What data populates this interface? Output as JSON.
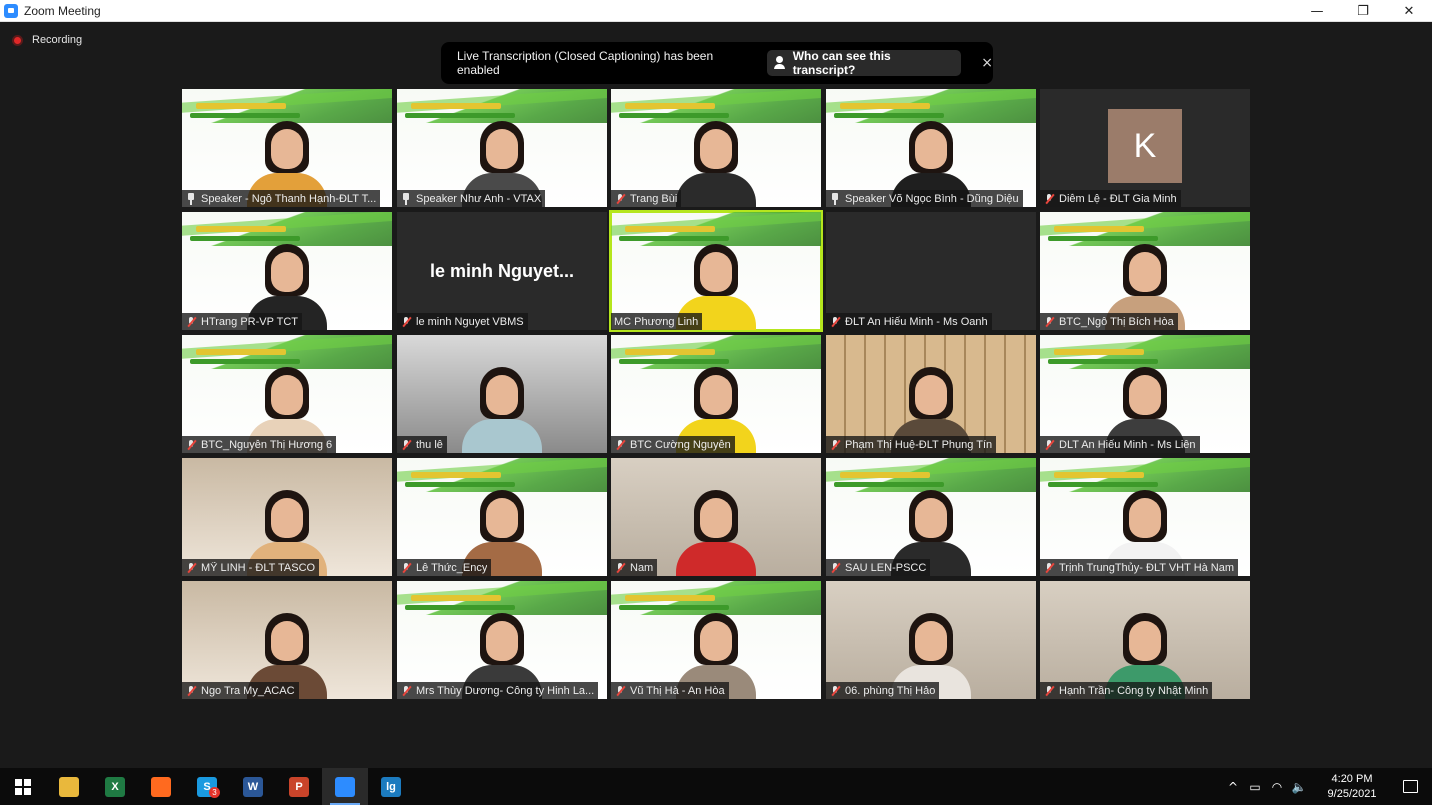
{
  "window": {
    "title": "Zoom Meeting",
    "minimize": "—",
    "maximize": "❐",
    "close": "✕"
  },
  "recording": {
    "label": "Recording"
  },
  "caption_banner": {
    "text": "Live Transcription (Closed Captioning) has been enabled",
    "who_button": "Who can see this transcript?",
    "close": "×"
  },
  "participants": [
    {
      "name": "Speaker - Ngô Thanh Hạnh-ĐLT T...",
      "icon": "pin-icon",
      "bg": "misa",
      "shirt": "#e3a03a"
    },
    {
      "name": "Speaker Như Anh - VTAX",
      "icon": "pin-icon",
      "bg": "misa",
      "shirt": "#4a4a4a"
    },
    {
      "name": "Trang Bùi",
      "icon": "mic-muted-icon",
      "bg": "misa",
      "shirt": "#2b2b2b"
    },
    {
      "name": "Speaker Võ Ngọc Bình - Dũng Diệu",
      "icon": "pin-icon",
      "bg": "misa",
      "shirt": "#1f1f1f"
    },
    {
      "name": "Diễm Lệ - ĐLT Gia Minh",
      "icon": "mic-muted-icon",
      "bg": "avatar",
      "avatar_letter": "K"
    },
    {
      "name": "HTrang PR-VP TCT",
      "icon": "mic-muted-icon",
      "bg": "misa",
      "shirt": "#242424"
    },
    {
      "name": "le minh Nguyet VBMS",
      "icon": "mic-muted-icon",
      "bg": "text",
      "display_name": "le minh Nguyet..."
    },
    {
      "name": "MC Phương Linh",
      "icon": "none",
      "bg": "misa",
      "shirt": "#f2d41c"
    },
    {
      "name": "ĐLT An Hiếu Minh - Ms Oanh",
      "icon": "mic-muted-icon",
      "bg": "dark"
    },
    {
      "name": "BTC_Ngô Thị Bích Hòa",
      "icon": "mic-muted-icon",
      "bg": "misa",
      "shirt": "#c7a07d"
    },
    {
      "name": "BTC_Nguyễn Thị Hương 6",
      "icon": "mic-muted-icon",
      "bg": "misa",
      "shirt": "#e8d2b9"
    },
    {
      "name": "thu lê",
      "icon": "mic-muted-icon",
      "bg": "office",
      "shirt": "#a9c7cf"
    },
    {
      "name": "BTC Cường Nguyễn",
      "icon": "mic-muted-icon",
      "bg": "misa",
      "shirt": "#f2d41c"
    },
    {
      "name": "Phạm Thị Huệ-ĐLT Phụng Tín",
      "icon": "mic-muted-icon",
      "bg": "shelf",
      "shirt": "#5a4a3a"
    },
    {
      "name": "DLT An Hiếu Minh - Ms Liên",
      "icon": "mic-muted-icon",
      "bg": "misa",
      "shirt": "#3d3d3d"
    },
    {
      "name": "MỸ LINH - ĐLT TASCO",
      "icon": "mic-muted-icon",
      "bg": "room",
      "shirt": "#e1b27c"
    },
    {
      "name": "Lê Thức_Ency",
      "icon": "mic-muted-icon",
      "bg": "misa",
      "shirt": "#a46b45"
    },
    {
      "name": "Nam",
      "icon": "mic-muted-icon",
      "bg": "wall",
      "shirt": "#cf2a2a"
    },
    {
      "name": "SAU LEN-PSCC",
      "icon": "mic-muted-icon",
      "bg": "misa",
      "shirt": "#2a2a2a"
    },
    {
      "name": "Trịnh TrungThủy- ĐLT VHT Hà Nam",
      "icon": "mic-muted-icon",
      "bg": "misa",
      "shirt": "#f2f2f2"
    },
    {
      "name": "Ngo Tra My_ACAC",
      "icon": "mic-muted-icon",
      "bg": "room",
      "shirt": "#6b4a36"
    },
    {
      "name": "Mrs Thùy Dương- Công ty Hinh La...",
      "icon": "mic-muted-icon",
      "bg": "misa",
      "shirt": "#3a3a3a"
    },
    {
      "name": "Vũ Thị Hà - An Hòa",
      "icon": "mic-muted-icon",
      "bg": "misa",
      "shirt": "#9a8a7a"
    },
    {
      "name": "06. phùng Thị Hảo",
      "icon": "mic-muted-icon",
      "bg": "wall",
      "shirt": "#e9e4de"
    },
    {
      "name": "Hạnh Trần- Công ty Nhật Minh",
      "icon": "mic-muted-icon",
      "bg": "wall",
      "shirt": "#3d9a6a"
    }
  ],
  "taskbar": {
    "apps": [
      {
        "name": "file-explorer-icon",
        "label": "",
        "color": "#e9b83c"
      },
      {
        "name": "excel-icon",
        "label": "X",
        "color": "#1f7a43"
      },
      {
        "name": "firefox-icon",
        "label": "",
        "color": "#ff6a1f"
      },
      {
        "name": "skype-icon",
        "label": "S",
        "color": "#1a9ae0",
        "badge": "3"
      },
      {
        "name": "word-icon",
        "label": "W",
        "color": "#2b5797"
      },
      {
        "name": "powerpoint-icon",
        "label": "P",
        "color": "#c9442a"
      },
      {
        "name": "zoom-icon",
        "label": "",
        "color": "#2d8cff",
        "active": true
      },
      {
        "name": "lg-app-icon",
        "label": "lg",
        "color": "#1c7bbf"
      }
    ],
    "clock": {
      "time": "4:20 PM",
      "date": "9/25/2021"
    },
    "tray": {
      "chevron": "^",
      "battery": "▭",
      "wifi": "◠",
      "volume": "🔈"
    }
  }
}
